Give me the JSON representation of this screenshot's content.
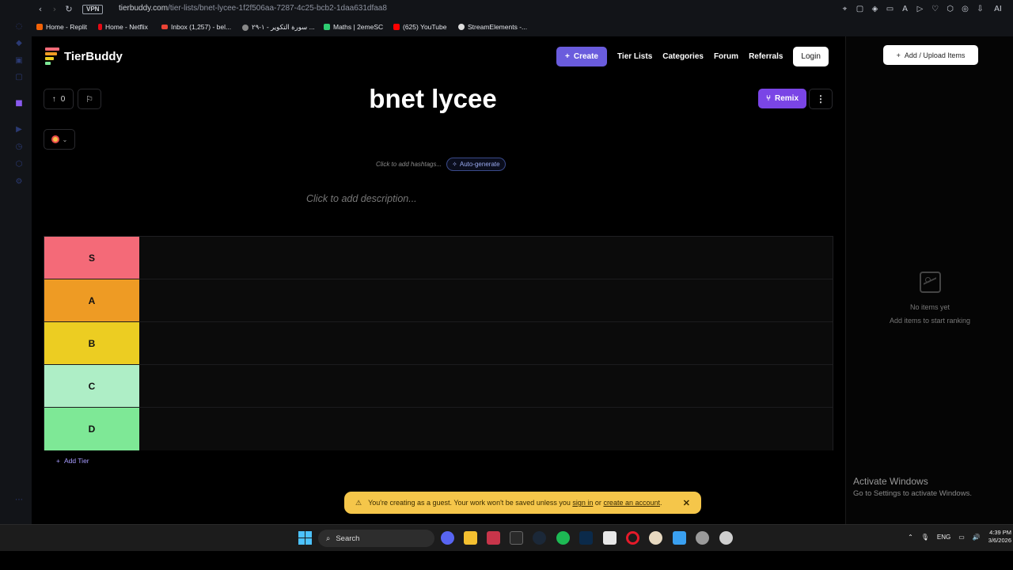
{
  "browser": {
    "url_host": "tierbuddy.com",
    "url_path": "/tier-lists/bnet-lycee-1f2f506aa-7287-4c25-bcb2-1daa631dfaa8",
    "vpn_label": "VPN",
    "bookmarks": [
      {
        "label": "Home - Replit",
        "icon": "replit-icon",
        "color": "#f26207"
      },
      {
        "label": "Home - Netflix",
        "icon": "netflix-icon",
        "color": "#e50914"
      },
      {
        "label": "Inbox (1,257) - bel...",
        "icon": "gmail-icon",
        "color": "#ea4335"
      },
      {
        "label": "سورة التكوير - ١-٢٩ ...",
        "icon": "globe-icon",
        "color": "#888888"
      },
      {
        "label": "Maths | 2emeSC",
        "icon": "maths-icon",
        "color": "#2ecc71"
      },
      {
        "label": "(625) YouTube",
        "icon": "youtube-icon",
        "color": "#ff0000"
      },
      {
        "label": "StreamElements -...",
        "icon": "streamelements-icon",
        "color": "#dddddd"
      }
    ]
  },
  "header": {
    "logo_text": "TierBuddy",
    "create_label": "Create",
    "nav": [
      "Tier Lists",
      "Categories",
      "Forum",
      "Referrals"
    ],
    "login_label": "Login"
  },
  "tierlist": {
    "title": "bnet lycee",
    "vote_count": "0",
    "remix_label": "Remix",
    "hashtag_hint": "Click to add hashtags...",
    "autogenerate_label": "Auto-generate",
    "description_placeholder": "Click to add description...",
    "tiers": [
      {
        "label": "S",
        "color": "#f46a78"
      },
      {
        "label": "A",
        "color": "#ee9b24"
      },
      {
        "label": "B",
        "color": "#eccd22"
      },
      {
        "label": "C",
        "color": "#aeeec6"
      },
      {
        "label": "D",
        "color": "#7ee896"
      }
    ],
    "add_tier_label": "Add Tier"
  },
  "toast": {
    "prefix": "You're creating as a guest. Your work won't be saved unless you",
    "sign_in": "sign in",
    "or": "or",
    "create_account": "create an account",
    "suffix": "."
  },
  "panel": {
    "upload_label": "Add / Upload Items",
    "empty_title": "No items yet",
    "empty_sub": "Add items to start ranking"
  },
  "watermark": {
    "title": "Activate Windows",
    "sub": "Go to Settings to activate Windows."
  },
  "taskbar": {
    "search_label": "Search",
    "lang": "ENG",
    "time": "4:39 PM",
    "date": "3/6/2026",
    "apps": [
      {
        "name": "discord-icon",
        "color": "#5865f2"
      },
      {
        "name": "file-explorer-icon",
        "color": "#f4c030"
      },
      {
        "name": "vivaldi-icon",
        "color": "#c8354a"
      },
      {
        "name": "epic-games-icon",
        "color": "#2a2a2a"
      },
      {
        "name": "steam-icon",
        "color": "#1b2838"
      },
      {
        "name": "spotify-icon",
        "color": "#1db954"
      },
      {
        "name": "photoshop-icon",
        "color": "#0b2a4a"
      },
      {
        "name": "store-icon",
        "color": "#e8e8e8"
      },
      {
        "name": "opera-icon",
        "color": "#e51a2a"
      },
      {
        "name": "game-icon",
        "color": "#e7d9c0"
      },
      {
        "name": "paint-icon",
        "color": "#3aa0f0"
      },
      {
        "name": "settings-icon",
        "color": "#9a9a9a"
      },
      {
        "name": "chrome-icon",
        "color": "#cfcfcf"
      }
    ]
  }
}
